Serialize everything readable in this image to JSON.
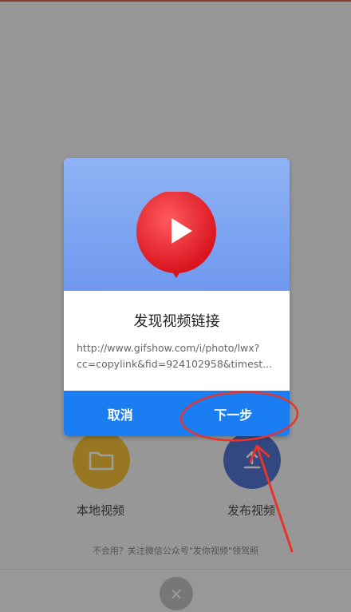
{
  "background": {
    "local_video_label": "本地视频",
    "publish_video_label": "发布视频",
    "hint": "不会用？关注微信公众号\"发你视频\"领驾照",
    "close_glyph": "×"
  },
  "dialog": {
    "title": "发现视频链接",
    "link_line1": "http://www.gifshow.com/i/photo/lwx?",
    "link_line2": "cc=copylink&fid=924102958&timest...",
    "cancel_label": "取消",
    "next_label": "下一步"
  },
  "colors": {
    "accent": "#1a7ef2",
    "balloon": "#e8222c",
    "annotation": "#e5342c"
  }
}
